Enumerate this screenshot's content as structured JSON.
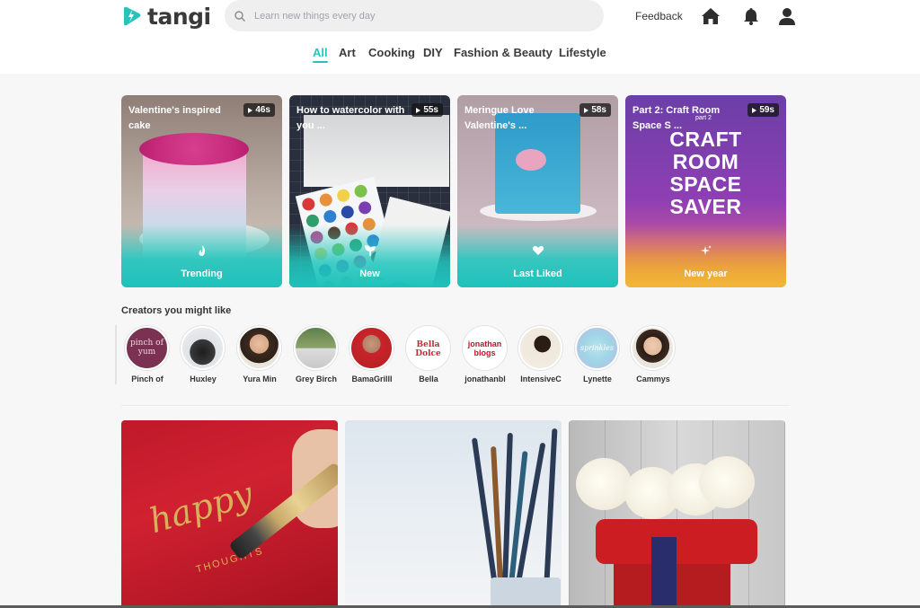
{
  "header": {
    "logo_text": "tangi",
    "search_placeholder": "Learn new things every day",
    "feedback_label": "Feedback",
    "accent_color": "#24c4bc"
  },
  "tabs": [
    "All",
    "Art",
    "Cooking",
    "DIY",
    "Fashion & Beauty",
    "Lifestyle"
  ],
  "active_tab": "All",
  "feature_cards": [
    {
      "title": "Valentine's inspired cake",
      "duration": "46s",
      "footer_label": "Trending",
      "footer_icon": "flame-icon"
    },
    {
      "title": "How to watercolor with you ...",
      "duration": "55s",
      "footer_label": "New",
      "footer_icon": "sprout-icon"
    },
    {
      "title": "Meringue Love Valentine's ...",
      "duration": "58s",
      "footer_label": "Last Liked",
      "footer_icon": "heart-icon"
    },
    {
      "title": "Part 2: Craft Room Space S ...",
      "duration": "59s",
      "footer_label": "New year",
      "footer_icon": "sparkle-icon",
      "overlay_sub": "part 2",
      "overlay_big": "CRAFT\nROOM\nSPACE\nSAVER"
    }
  ],
  "creators": {
    "title": "Creators you might like",
    "items": [
      {
        "name": "Pinch of",
        "avatar_text": "pinch of yum"
      },
      {
        "name": "Huxley",
        "avatar_text": ""
      },
      {
        "name": "Yura Min",
        "avatar_text": ""
      },
      {
        "name": "Grey Birch",
        "avatar_text": ""
      },
      {
        "name": "BamaGrillI",
        "avatar_text": ""
      },
      {
        "name": "Bella",
        "avatar_text": "Bella Dolce"
      },
      {
        "name": "jonathanbl",
        "avatar_text": "jonathan blogs"
      },
      {
        "name": "IntensiveC",
        "avatar_text": ""
      },
      {
        "name": "Lynette",
        "avatar_text": "sprinkles"
      },
      {
        "name": "Cammys",
        "avatar_text": ""
      }
    ]
  },
  "tiles": [
    {
      "overlay": "happy",
      "overlay_sub": "THOUGHTS"
    },
    {
      "overlay": ""
    },
    {
      "overlay": ""
    }
  ]
}
